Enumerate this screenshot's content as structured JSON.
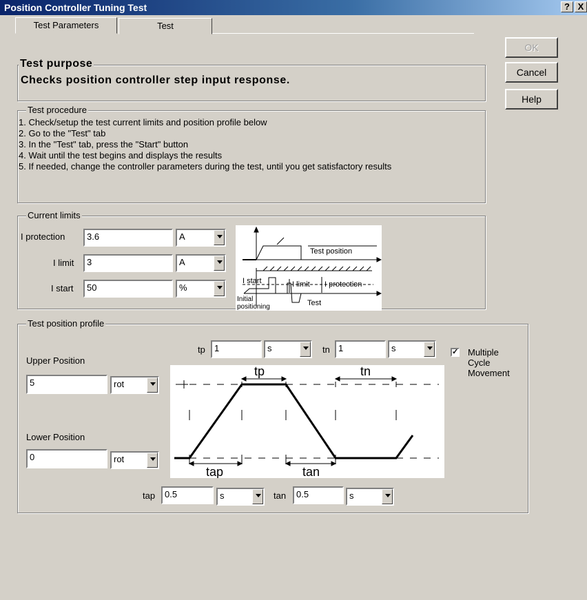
{
  "window": {
    "title": "Position Controller Tuning Test",
    "help_button": "?",
    "close_button": "X"
  },
  "tabs": [
    {
      "label": "Test Parameters",
      "active": true
    },
    {
      "label": "Test",
      "active": false
    }
  ],
  "buttons": {
    "ok": "OK",
    "cancel": "Cancel",
    "help": "Help"
  },
  "purpose": {
    "legend": "Test purpose",
    "text": "Checks position controller step input response."
  },
  "procedure": {
    "legend": "Test procedure",
    "steps": [
      "1. Check/setup the test current limits and position profile below",
      "2. Go to the \"Test\" tab",
      "3. In the \"Test\" tab, press the \"Start\" button",
      "4. Wait until the test begins and displays the results",
      "5. If needed, change the controller parameters during the test, until you get satisfactory results"
    ]
  },
  "current_limits": {
    "legend": "Current limits",
    "i_protection": {
      "label": "I protection",
      "value": "3.6",
      "unit": "A"
    },
    "i_limit": {
      "label": "I limit",
      "value": "3",
      "unit": "A"
    },
    "i_start": {
      "label": "I start",
      "value": "50",
      "unit": "%"
    },
    "diagram": {
      "test_position": "Test position",
      "i_start": "I start",
      "i_limit": "I limit",
      "i_protection": "I protection",
      "initial": "Initial",
      "positioning": "positioning",
      "test": "Test"
    }
  },
  "profile": {
    "legend": "Test position profile",
    "upper": {
      "label": "Upper Position",
      "value": "5",
      "unit": "rot"
    },
    "lower": {
      "label": "Lower Position",
      "value": "0",
      "unit": "rot"
    },
    "tp": {
      "label": "tp",
      "value": "1",
      "unit": "s"
    },
    "tn": {
      "label": "tn",
      "value": "1",
      "unit": "s"
    },
    "tap": {
      "label": "tap",
      "value": "0.5",
      "unit": "s"
    },
    "tan": {
      "label": "tan",
      "value": "0.5",
      "unit": "s"
    },
    "multiple_cycle": {
      "label_1": "Multiple",
      "label_2": "Cycle",
      "label_3": "Movement",
      "checked": true,
      "mark": "✓"
    },
    "diagram": {
      "tp": "tp",
      "tn": "tn",
      "tap": "tap",
      "tan": "tan"
    }
  }
}
